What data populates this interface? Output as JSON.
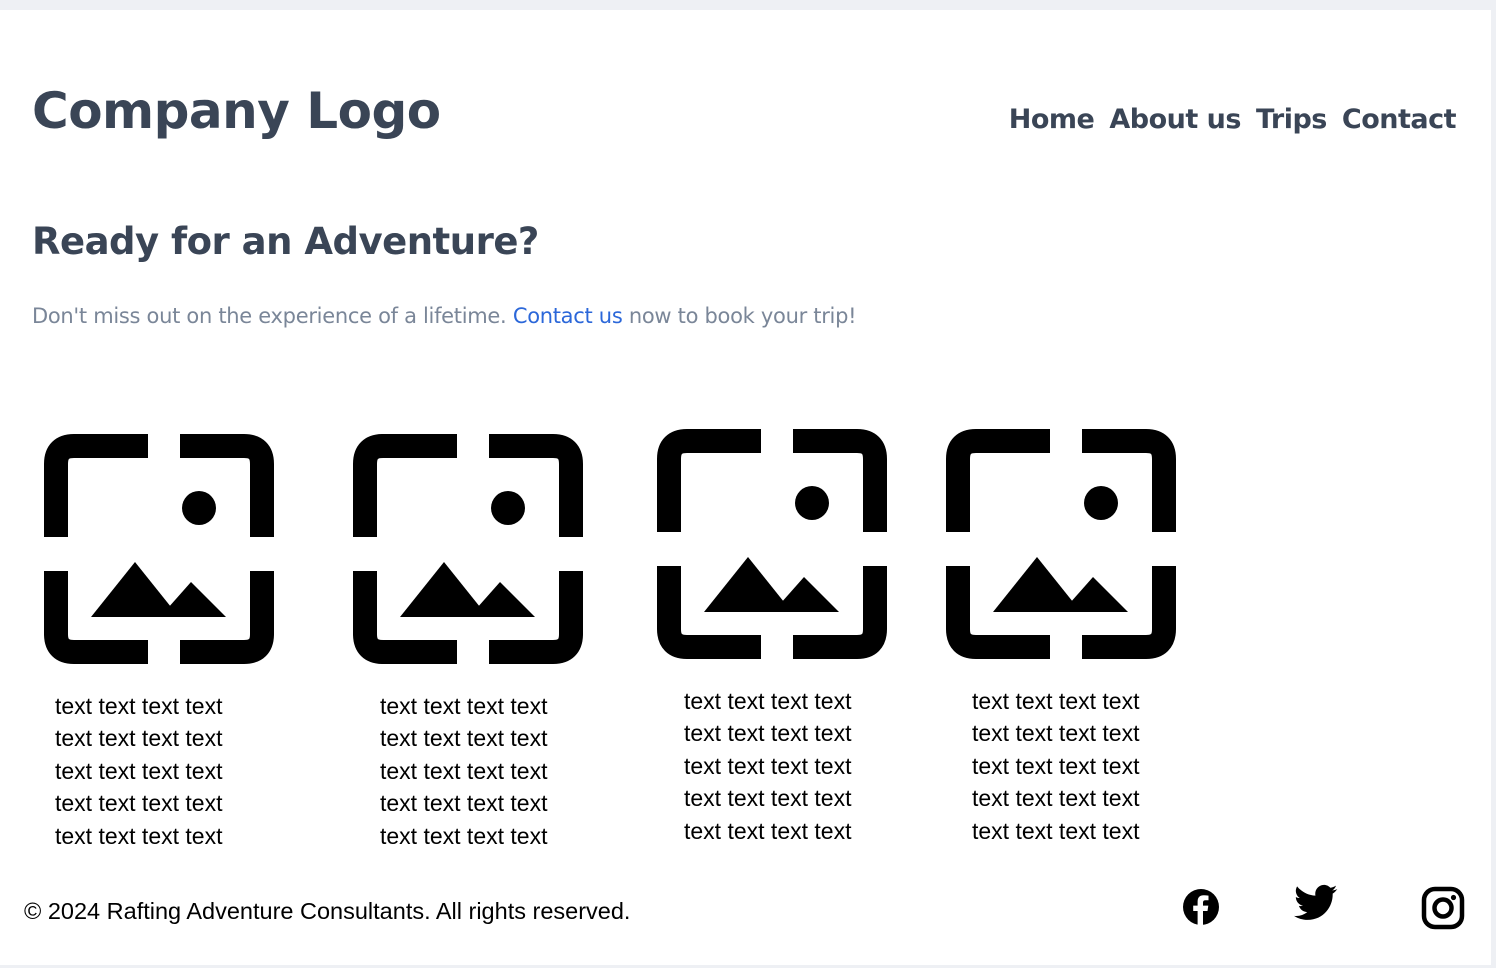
{
  "header": {
    "logo": "Company Logo",
    "nav": [
      {
        "label": "Home"
      },
      {
        "label": "About us"
      },
      {
        "label": "Trips"
      },
      {
        "label": "Contact"
      }
    ]
  },
  "hero": {
    "title": "Ready for an Adventure?",
    "text_before": "Don't miss out on the experience of a lifetime.",
    "link": "Contact us",
    "text_after": "now to book your trip!"
  },
  "cards": [
    {
      "image_icon": "image-placeholder-icon",
      "lines": [
        "text text text text",
        "text text text text",
        "text text text text",
        "text text text text",
        "text text text text"
      ]
    },
    {
      "image_icon": "image-placeholder-icon",
      "lines": [
        "text text text text",
        "text text text text",
        "text text text text",
        "text text text text",
        "text text text text"
      ]
    },
    {
      "image_icon": "image-placeholder-icon",
      "lines": [
        "text text text text",
        "text text text text",
        "text text text text",
        "text text text text",
        "text text text text"
      ]
    },
    {
      "image_icon": "image-placeholder-icon",
      "lines": [
        "text text text text",
        "text text text text",
        "text text text text",
        "text text text text",
        "text text text text"
      ]
    }
  ],
  "footer": {
    "copyright": "© 2024 Rafting Adventure Consultants. All rights reserved.",
    "social": [
      "facebook-icon",
      "twitter-icon",
      "instagram-icon"
    ]
  },
  "colors": {
    "heading": "#3a4556",
    "muted": "#7a8698",
    "link": "#2b67d9",
    "background": "#eef0f4"
  }
}
